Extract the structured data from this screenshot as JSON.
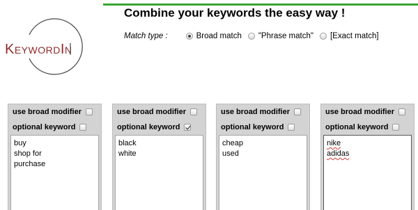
{
  "logo": {
    "text": "KeywordIn"
  },
  "header": {
    "title": "Combine your keywords the easy way !",
    "match_type": {
      "label": "Match type :",
      "options": [
        {
          "label": "Broad match",
          "selected": true
        },
        {
          "label": "\"Phrase match\"",
          "selected": false
        },
        {
          "label": "[Exact match]",
          "selected": false
        }
      ]
    }
  },
  "columns": [
    {
      "broad_modifier_label": "use broad modifier",
      "broad_modifier_checked": false,
      "optional_label": "optional keyword",
      "optional_checked": false,
      "keywords": [
        "buy",
        "shop for",
        "purchase"
      ]
    },
    {
      "broad_modifier_label": "use broad modifier",
      "broad_modifier_checked": false,
      "optional_label": "optional keyword",
      "optional_checked": true,
      "keywords": [
        "black",
        "white"
      ]
    },
    {
      "broad_modifier_label": "use broad modifier",
      "broad_modifier_checked": false,
      "optional_label": "optional keyword",
      "optional_checked": false,
      "keywords": [
        "cheap",
        "used"
      ]
    },
    {
      "broad_modifier_label": "use broad modifier",
      "broad_modifier_checked": false,
      "optional_label": "optional keyword",
      "optional_checked": false,
      "keywords": [
        "nike",
        "adidas"
      ]
    }
  ],
  "colors": {
    "accent_bar": "#3aa635",
    "logo_text": "#8e2b2b",
    "column_bg": "#d3d3d3"
  }
}
